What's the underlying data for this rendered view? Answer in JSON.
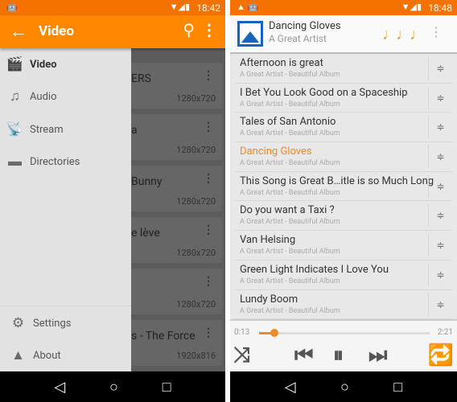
{
  "left": {
    "status": {
      "time": "18:42"
    },
    "toolbar": {
      "title": "Video"
    },
    "drawer": {
      "items": [
        {
          "label": "Video",
          "icon": "clapperboard-icon"
        },
        {
          "label": "Audio",
          "icon": "music-note-icon"
        },
        {
          "label": "Stream",
          "icon": "antenna-icon"
        },
        {
          "label": "Directories",
          "icon": "folder-icon"
        }
      ],
      "footer": [
        {
          "label": "Settings",
          "icon": "gear-icon"
        },
        {
          "label": "About",
          "icon": "vlc-cone-icon"
        }
      ]
    },
    "cards": [
      {
        "title": "ERS",
        "res": "1280x720"
      },
      {
        "title": "a",
        "res": "1280x720"
      },
      {
        "title": "Bunny",
        "res": "1280x720"
      },
      {
        "title": "e lève",
        "res": "1280x720"
      },
      {
        "title": "",
        "res": "1280x720"
      },
      {
        "title": "s - The Force",
        "res": "1920x816"
      }
    ]
  },
  "right": {
    "status": {
      "time": "18:48"
    },
    "now_playing": {
      "title": "Dancing Gloves",
      "artist": "A Great Artist"
    },
    "playlist": [
      {
        "title": "Afternoon is great",
        "sub": "A Great Artist - Beautiful Album"
      },
      {
        "title": "I Bet You Look Good on a Spaceship",
        "sub": "A Great Artist - Beautiful Album"
      },
      {
        "title": "Tales of San Antonio",
        "sub": "A Great Artist - Beautiful Album"
      },
      {
        "title": "Dancing Gloves",
        "sub": "A Great Artist - Beautiful Album",
        "current": true
      },
      {
        "title": "This Song is Great B…itle is so Much Long",
        "sub": "A Great Artist - Beautiful Album"
      },
      {
        "title": "Do you want a Taxi ?",
        "sub": "A Great Artist - Beautiful Album"
      },
      {
        "title": "Van Helsing",
        "sub": "A Great Artist - Beautiful Album"
      },
      {
        "title": "Green Light Indicates I Love You",
        "sub": "A Great Artist - Beautiful Album"
      },
      {
        "title": "Lundy Boom",
        "sub": "A Great Artist - Beautiful Album"
      }
    ],
    "player": {
      "elapsed": "0:13",
      "total": "2:21",
      "progress": 0.09
    },
    "accent": "#f08a24"
  }
}
